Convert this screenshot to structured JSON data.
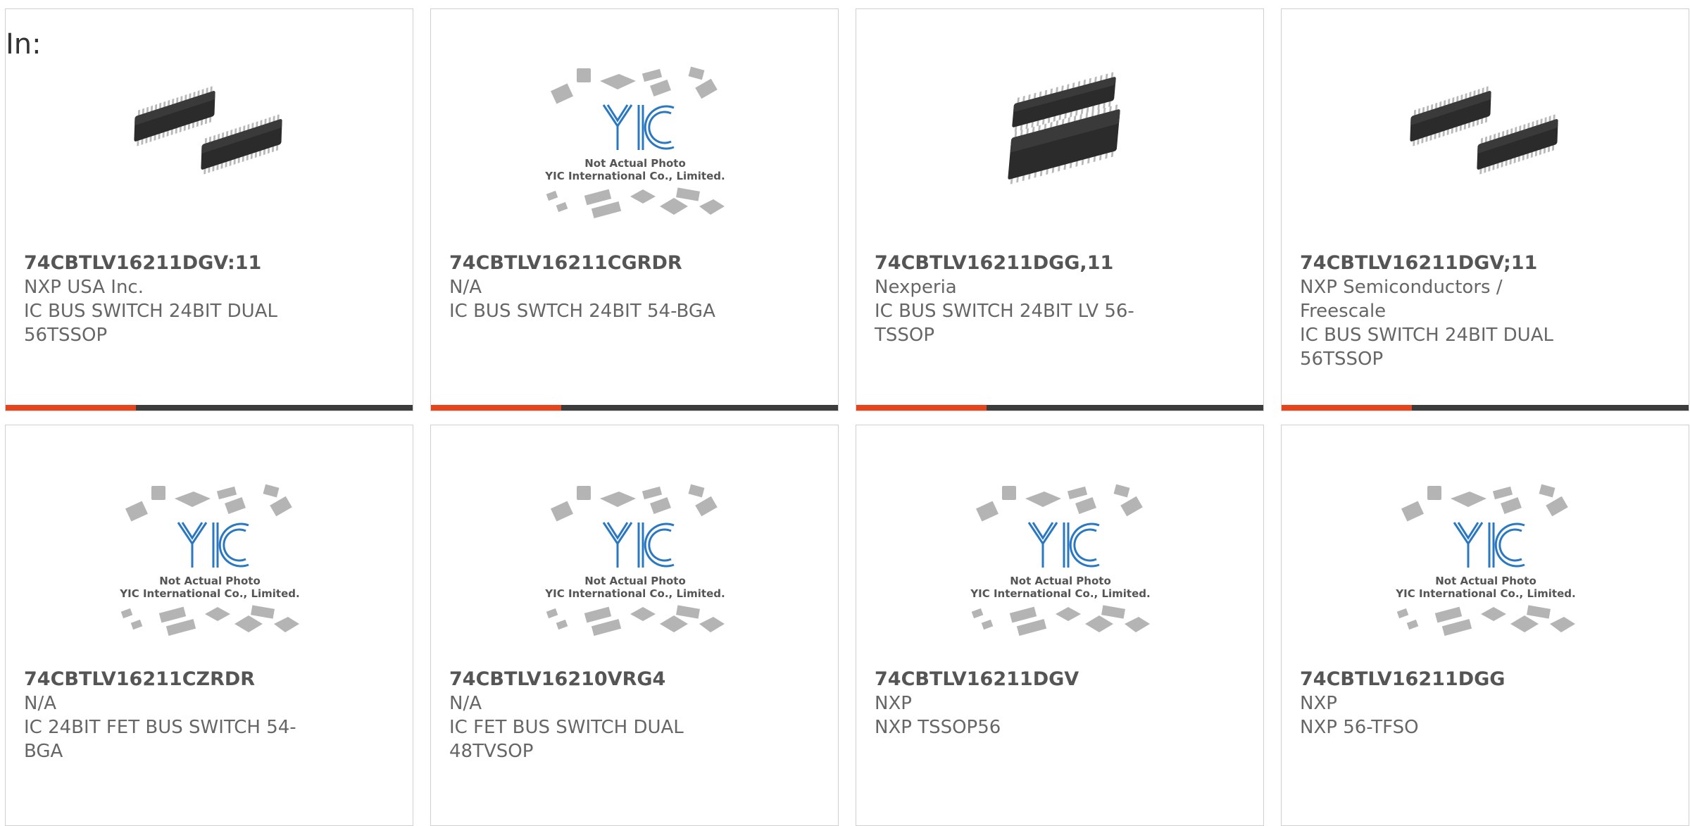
{
  "page": {
    "label": "In:"
  },
  "placeholder_image": {
    "brand": "YIC",
    "caption_line1": "Not Actual Photo",
    "caption_line2": "YIC International Co., Limited."
  },
  "colors": {
    "progress_fill": "#e8441c",
    "progress_track": "#3c3c3c",
    "yic_blue": "#2a78c2"
  },
  "products": [
    {
      "part": "74CBTLV16211DGV:11",
      "maker": "NXP USA Inc.",
      "desc": "IC BUS SWITCH 24BIT DUAL 56TSSOP",
      "image": "chip-photo-dual",
      "progress": 0.32
    },
    {
      "part": "74CBTLV16211CGRDR",
      "maker": "N/A",
      "desc": "IC BUS SWTCH 24BIT 54-BGA",
      "image": "yic-placeholder",
      "progress": 0.32
    },
    {
      "part": "74CBTLV16211DGG,11",
      "maker": "Nexperia",
      "desc": "IC BUS SWITCH 24BIT LV 56-TSSOP",
      "image": "chip-photo-stacked",
      "progress": 0.32
    },
    {
      "part": "74CBTLV16211DGV;11",
      "maker": "NXP Semiconductors / Freescale",
      "desc": "IC BUS SWITCH 24BIT DUAL 56TSSOP",
      "image": "chip-photo-dual",
      "progress": 0.32
    },
    {
      "part": "74CBTLV16211CZRDR",
      "maker": "N/A",
      "desc": "IC 24BIT FET BUS SWITCH 54-BGA",
      "image": "yic-placeholder"
    },
    {
      "part": "74CBTLV16210VRG4",
      "maker": "N/A",
      "desc": "IC FET BUS SWITCH DUAL 48TVSOP",
      "image": "yic-placeholder"
    },
    {
      "part": "74CBTLV16211DGV",
      "maker": "NXP",
      "desc": "NXP TSSOP56",
      "image": "yic-placeholder"
    },
    {
      "part": "74CBTLV16211DGG",
      "maker": "NXP",
      "desc": "NXP 56-TFSO",
      "image": "yic-placeholder"
    }
  ]
}
